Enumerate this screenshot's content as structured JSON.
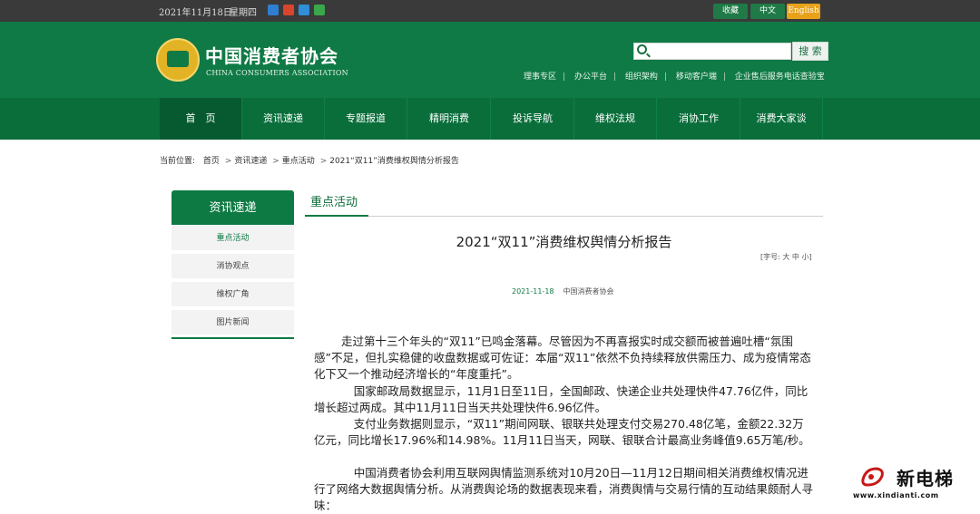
{
  "topbar": {
    "date": "2021年11月18日",
    "weekday": "星期四",
    "social_icons": [
      "sina-weibo-icon",
      "rss-icon",
      "qq-icon",
      "wechat-icon"
    ],
    "buttons": [
      "收藏",
      "中文",
      "English"
    ]
  },
  "header": {
    "logo_cn": "中国消费者协会",
    "logo_en": "CHINA CONSUMERS ASSOCIATION",
    "search_placeholder": "",
    "search_button": "搜 索",
    "links": [
      "理事专区",
      "办公平台",
      "组织架构",
      "移动客户端",
      "企业售后服务电话查验宝"
    ]
  },
  "nav": [
    "首　页",
    "资讯速递",
    "专题报道",
    "精明消费",
    "投诉导航",
    "维权法规",
    "消协工作",
    "消费大家谈"
  ],
  "breadcrumb": {
    "label": "当前位置:",
    "items": [
      "首页",
      "资讯速递",
      "重点活动",
      "2021“双11”消费维权舆情分析报告"
    ]
  },
  "sidebar": {
    "title": "资讯速递",
    "items": [
      "重点活动",
      "消协观点",
      "维权广角",
      "图片新闻"
    ]
  },
  "article": {
    "section": "重点活动",
    "title": "2021“双11”消费维权舆情分析报告",
    "font_size_label": "[字号: 大 中 小]",
    "date": "2021-11-18",
    "source": "中国消费者协会",
    "paragraphs": [
      "走过第十三个年头的“双11”已鸣金落幕。尽管因为不再喜报实时成交额而被普遍吐槽“氛围感”不足，但扎实稳健的收盘数据或可佐证：本届“双11”依然不负持续释放供需压力、成为疫情常态化下又一个推动经济增长的“年度重托”。",
      "国家邮政局数据显示，11月1日至11日，全国邮政、快递企业共处理快件47.76亿件，同比增长超过两成。其中11月11日当天共处理快件6.96亿件。",
      "支付业务数据则显示，“双11”期间网联、银联共处理支付交易270.48亿笔，金额22.32万亿元，同比增长17.96%和14.98%。11月11日当天，网联、银联合计最高业务峰值9.65万笔/秒。",
      "中国消费者协会利用互联网舆情监测系统对10月20日—11月12日期间相关消费维权情况进行了网络大数据舆情分析。从消费舆论场的数据表现来看，消费舆情与交易行情的互动结果颇耐人寻味："
    ]
  },
  "watermark": {
    "brand": "新电梯",
    "url": "www.xindianti.com"
  },
  "colors": {
    "brand_green": "#0f7a45",
    "nav_green": "#0a6e3b",
    "english_button": "#e8a21a"
  }
}
